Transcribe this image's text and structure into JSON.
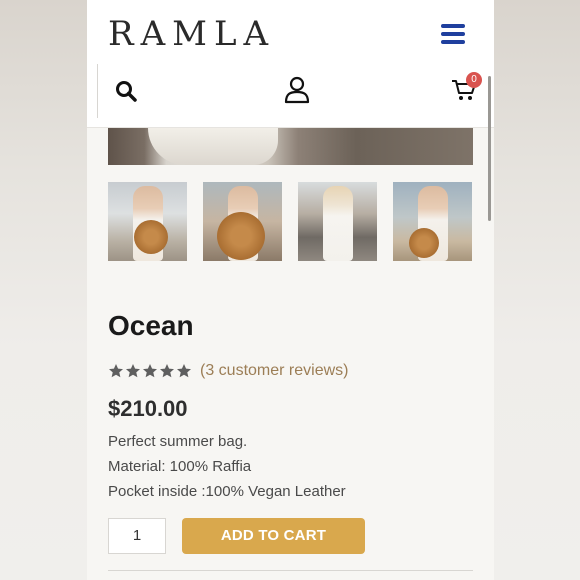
{
  "header": {
    "logo": "RAMLA",
    "cart_count": "0",
    "accent_color": "#1f3f9e",
    "icons": [
      "menu-icon",
      "search-icon",
      "user-icon",
      "cart-icon"
    ]
  },
  "gallery": {
    "thumbnail_count": 4
  },
  "product": {
    "title": "Ocean",
    "rating_stars": 5,
    "reviews_text": "(3 customer reviews)",
    "price": "$210.00",
    "description": [
      "Perfect summer bag.",
      "Material: 100% Raffia",
      "Pocket inside :100% Vegan Leather"
    ],
    "quantity": "1",
    "add_to_cart_label": "ADD TO CART",
    "button_color": "#d9a84d"
  }
}
